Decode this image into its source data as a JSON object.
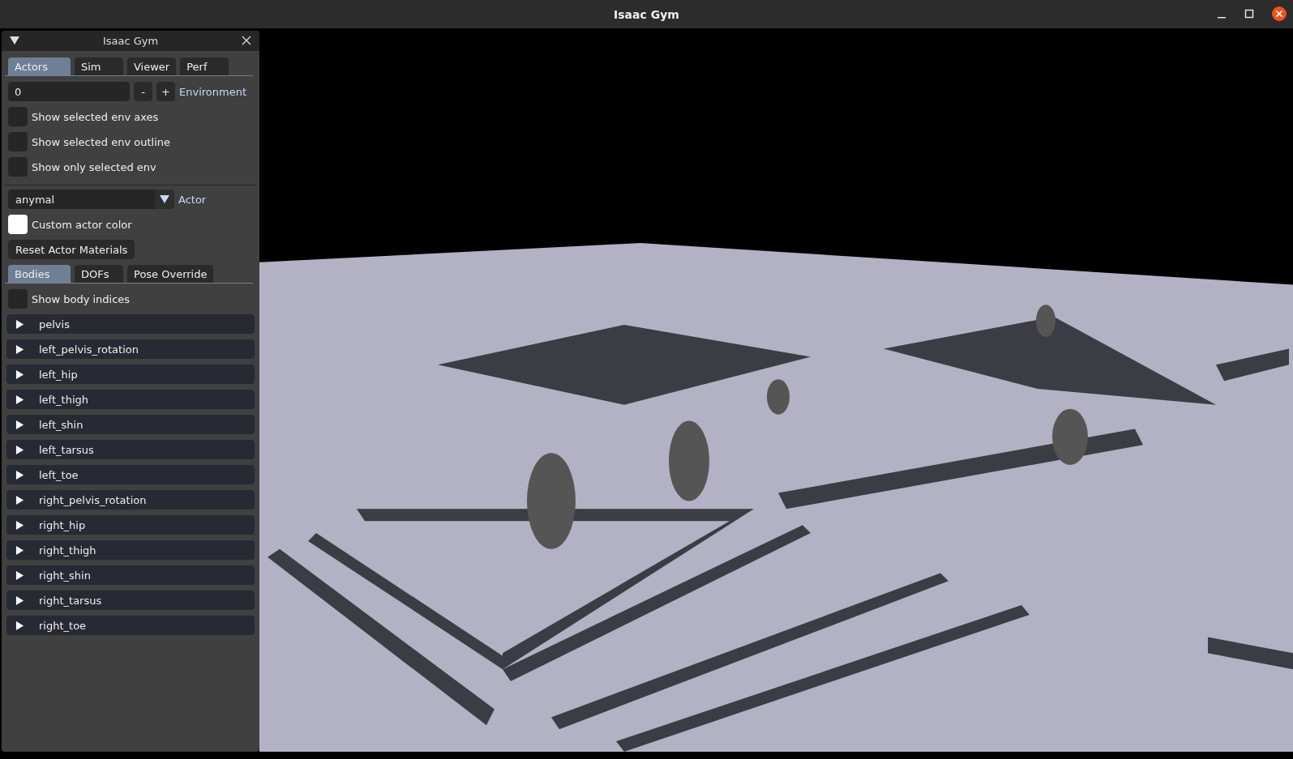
{
  "window": {
    "title": "Isaac Gym"
  },
  "panel": {
    "title": "Isaac Gym",
    "tabs": [
      {
        "label": "Actors",
        "selected": true
      },
      {
        "label": "Sim",
        "selected": false
      },
      {
        "label": "Viewer",
        "selected": false
      },
      {
        "label": "Perf",
        "selected": false
      }
    ],
    "environment": {
      "value": "0",
      "minus": "-",
      "plus": "+",
      "label": "Environment"
    },
    "env_options": [
      {
        "label": "Show selected env axes",
        "checked": false
      },
      {
        "label": "Show selected env outline",
        "checked": false
      },
      {
        "label": "Show only selected env",
        "checked": false
      }
    ],
    "actor": {
      "value": "anymal",
      "label": "Actor"
    },
    "custom_color": {
      "label": "Custom actor color"
    },
    "reset_button": "Reset Actor Materials",
    "body_tabs": [
      {
        "label": "Bodies",
        "selected": true
      },
      {
        "label": "DOFs",
        "selected": false
      },
      {
        "label": "Pose Override",
        "selected": false
      }
    ],
    "body_options": [
      {
        "label": "Show body indices",
        "checked": false
      }
    ],
    "bodies": [
      {
        "name": "pelvis",
        "expanded": false
      },
      {
        "name": "left_pelvis_rotation",
        "expanded": false
      },
      {
        "name": "left_hip",
        "expanded": false
      },
      {
        "name": "left_thigh",
        "expanded": false
      },
      {
        "name": "left_shin",
        "expanded": false
      },
      {
        "name": "left_tarsus",
        "expanded": false
      },
      {
        "name": "left_toe",
        "expanded": false
      },
      {
        "name": "right_pelvis_rotation",
        "expanded": false
      },
      {
        "name": "right_hip",
        "expanded": false
      },
      {
        "name": "right_thigh",
        "expanded": false
      },
      {
        "name": "right_shin",
        "expanded": false
      },
      {
        "name": "right_tarsus",
        "expanded": false
      },
      {
        "name": "right_toe",
        "expanded": false
      }
    ]
  }
}
